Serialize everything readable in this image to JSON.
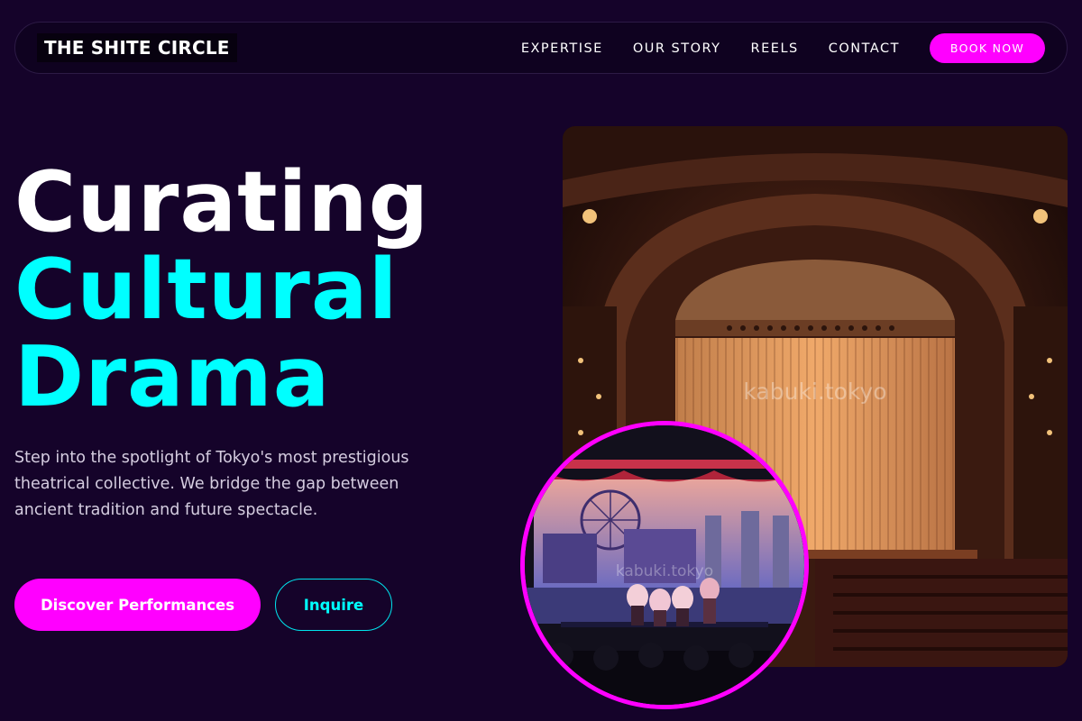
{
  "nav": {
    "brand": "THE SHITE CIRCLE",
    "links": [
      "EXPERTISE",
      "OUR STORY",
      "REELS",
      "CONTACT"
    ],
    "cta": "BOOK NOW"
  },
  "hero": {
    "headline": [
      "Curating",
      "Cultural",
      "Drama"
    ],
    "lead": "Step into the spotlight of Tokyo's most prestigious theatrical collective. We bridge the gap between ancient tradition and future spectacle.",
    "primary_button": "Discover Performances",
    "secondary_button": "Inquire"
  },
  "media": {
    "theater_watermark": "kabuki.tokyo",
    "stage_watermark": "kabuki.tokyo"
  },
  "colors": {
    "background": "#15032a",
    "accent_magenta": "#ff00ff",
    "accent_cyan": "#00ffff"
  }
}
